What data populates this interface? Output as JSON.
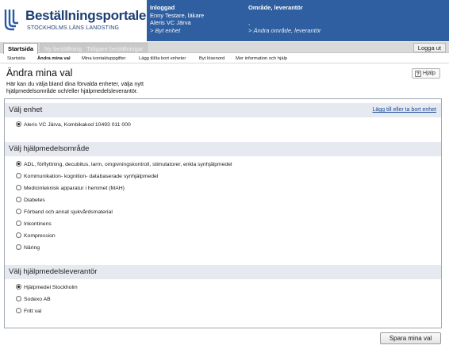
{
  "header": {
    "logo_title": "Beställningsportalen",
    "logo_subtitle": "STOCKHOLMS LÄNS LANDSTING",
    "user": {
      "heading": "Inloggad",
      "name": "Enny Testare, läkare",
      "unit": "Aleris VC Järva",
      "change_unit_link": "> Byt enhet"
    },
    "area": {
      "heading": "Område, leverantör",
      "value": ",",
      "change_area_link": "> Ändra område, leverantör"
    },
    "bar_color": "#2f5fa0"
  },
  "tabs": [
    {
      "label": "Startsida",
      "active": true
    },
    {
      "label": "Ny beställning",
      "active": false
    },
    {
      "label": "Tidigare beställningar",
      "active": false
    }
  ],
  "logout_label": "Logga ut",
  "subnav": [
    {
      "label": "Startsida",
      "active": false
    },
    {
      "label": "Ändra mina val",
      "active": true
    },
    {
      "label": "Mina kontaktuppgifter",
      "active": false
    },
    {
      "label": "Lägg till/ta bort enheter",
      "active": false
    },
    {
      "label": "Byt lösenord",
      "active": false
    },
    {
      "label": "Mer information och hjälp",
      "active": false
    }
  ],
  "page": {
    "title": "Ändra mina val",
    "intro_line1": "Här kan du välja bland dina förvalda enheter, välja nytt",
    "intro_line2": "hjälpmedelsområde och/eller hjälpmedelsleverantör.",
    "help_label": "Hjälp",
    "help_icon": "question-icon"
  },
  "sections": {
    "unit": {
      "heading": "Välj enhet",
      "link": "Lägg till eller ta bort enhet",
      "options": [
        {
          "label": "Aleris VC Järva, Kombikakod 10493 011 000",
          "checked": true
        }
      ]
    },
    "area": {
      "heading": "Välj hjälpmedelsområde",
      "options": [
        {
          "label": "ADL, förflyttning, decubitus, larm, omgivningskontroll, stimulatorer, enkla synhjälpmedel",
          "checked": true
        },
        {
          "label": "Kommunikation- kognition- databaserade synhjälpmedel",
          "checked": false
        },
        {
          "label": "Medicinteknisk apparatur i hemmet (MAH)",
          "checked": false
        },
        {
          "label": "Diabetes",
          "checked": false
        },
        {
          "label": "Förband och annat sjukvårdsmaterial",
          "checked": false
        },
        {
          "label": "Inkontinens",
          "checked": false
        },
        {
          "label": "Kompression",
          "checked": false
        },
        {
          "label": "Näring",
          "checked": false
        }
      ]
    },
    "supplier": {
      "heading": "Välj hjälpmedelsleverantör",
      "options": [
        {
          "label": "Hjälpmedel Stockholm",
          "checked": true
        },
        {
          "label": "Sodexo AB",
          "checked": false
        },
        {
          "label": "Fritt val",
          "checked": false
        }
      ]
    }
  },
  "save_label": "Spara mina val"
}
